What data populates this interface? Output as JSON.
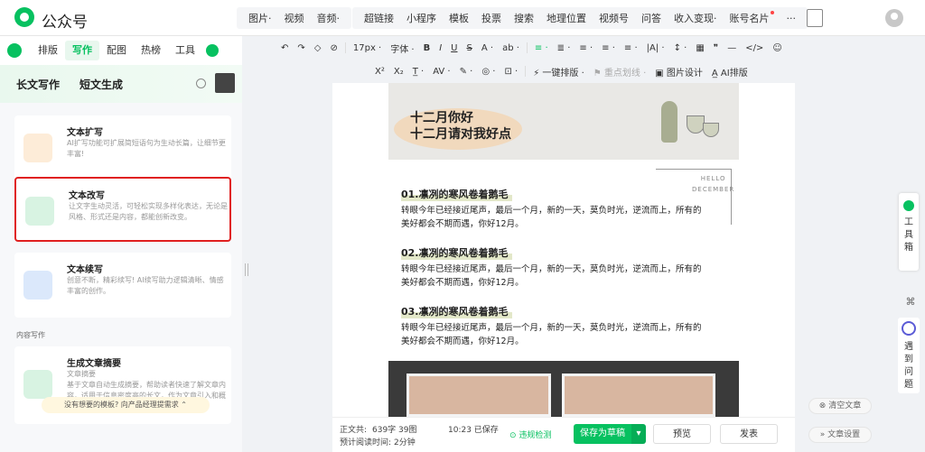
{
  "app": {
    "brand": "公众号"
  },
  "insert_groups": [
    [
      "图片·",
      "视频",
      "音频·"
    ],
    [
      "超链接",
      "小程序",
      "模板",
      "投票",
      "搜索",
      "地理位置",
      "视频号",
      "问答",
      "收入变现·",
      "账号名片",
      "···"
    ]
  ],
  "side_tabs": [
    "排版",
    "写作",
    "配图",
    "热榜",
    "工具"
  ],
  "sub_tabs": [
    "长文写作",
    "短文生成"
  ],
  "cards": [
    {
      "title": "文本扩写",
      "desc": "AI扩写功能可扩展简短语句为生动长篇，让细节更丰富!"
    },
    {
      "title": "文本改写",
      "desc": "让文字生动灵活，可轻松实现多样化表达，无论是风格、形式还是内容，都能创新改变。"
    },
    {
      "title": "文本续写",
      "desc": "创意不断，精彩续写! AI续写助力逻辑清晰、情感丰富的创作。"
    },
    {
      "title": "生成文章摘要",
      "sub": "文章摘要",
      "desc": "基于文章自动生成摘要，帮助读者快速了解文章内容，适用于信息密度高的长文，作为文章引入和概述"
    }
  ],
  "section_label": "内容写作",
  "feedback": "没有想要的模板? 向产品经理提需求 ⌃",
  "toolbar1": [
    "↶",
    "↷",
    "◇",
    "⊘",
    "17px ·",
    "字体 ·",
    "B",
    "I",
    "U",
    "S",
    "A ·",
    "ab ·",
    "≡ ·",
    "≣ ·",
    "≡ ·",
    "≡ ·",
    "≡ ·",
    "|A| ·",
    "↕ ·",
    "▦",
    "❞",
    "—",
    "</>",
    "☺"
  ],
  "toolbar2": [
    "X²",
    "X₂",
    "T̲ ·",
    "AV ·",
    "✎ ·",
    "◎ ·",
    "⊡ ·",
    "⚡ 一键排版 ·",
    "⚑ 重点划线 ·",
    "▣ 图片设计",
    "A̲ AI排版"
  ],
  "article": {
    "banner_line1": "十二月你好",
    "banner_line2": "十二月请对我好点",
    "hello": "HELLO",
    "december": "DECEMBER",
    "sections": [
      {
        "heading": "01.凛冽的寒风卷着鹅毛",
        "line1": "转眼今年已经接近尾声，最后一个月，新的一天，莫负时光，逆流而上，所有的",
        "line2": "美好都会不期而遇，你好12月。"
      },
      {
        "heading": "02.凛冽的寒风卷着鹅毛",
        "line1": "转眼今年已经接近尾声，最后一个月，新的一天，莫负时光，逆流而上，所有的",
        "line2": "美好都会不期而遇，你好12月。"
      },
      {
        "heading": "03.凛冽的寒风卷着鹅毛",
        "line1": "转眼今年已经接近尾声，最后一个月，新的一天，莫负时光，逆流而上，所有的",
        "line2": "美好都会不期而遇，你好12月。"
      }
    ]
  },
  "status": {
    "word_label": "正文共:",
    "word_count": "639字 39图",
    "read_label": "预计阅读时间:",
    "read_time": "2分钟",
    "saved": "10:23 已保存",
    "check": "违规检测"
  },
  "buttons": {
    "save": "保存为草稿",
    "preview": "预览",
    "publish": "发表"
  },
  "right_panel": {
    "toolbox": "工具箱",
    "ask": "遇到问题",
    "clear": "清空文章",
    "settings": "文章设置"
  }
}
